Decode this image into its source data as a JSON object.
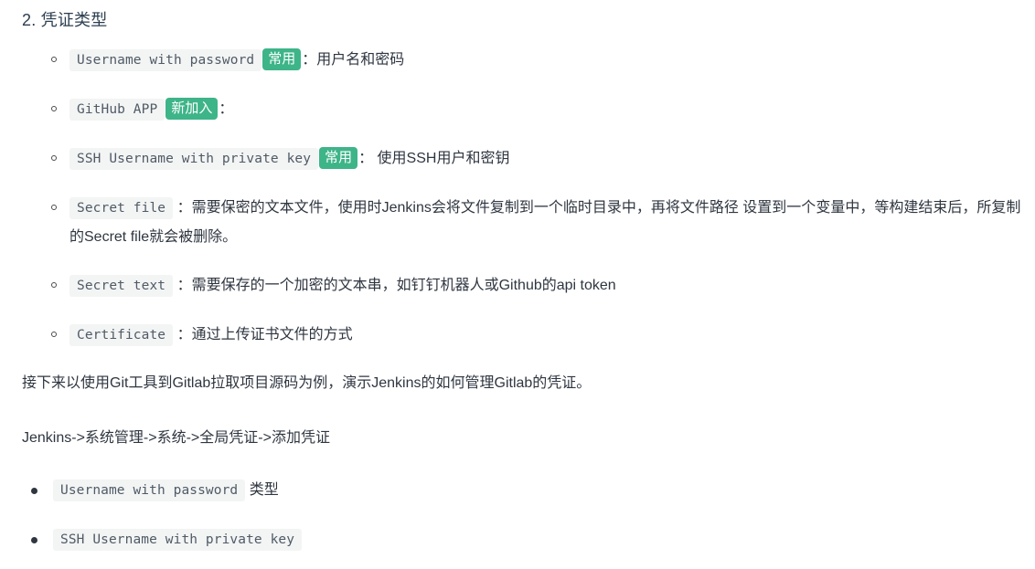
{
  "document": {
    "heading": "2. 凭证类型",
    "credential_types": [
      {
        "code": "Username with password",
        "badge": "常用",
        "separator": "：",
        "description": "用户名和密码",
        "extra_line": ""
      },
      {
        "code": "GitHub APP",
        "badge": "新加入",
        "separator": "：",
        "description": "",
        "extra_line": ""
      },
      {
        "code": "SSH Username with private key",
        "badge": "常用",
        "separator": "：",
        "description": " 使用SSH用户和密钥",
        "extra_line": ""
      },
      {
        "code": "Secret file",
        "badge": "",
        "separator": "：",
        "description": "需要保密的文本文件，使用时Jenkins会将文件复制到一个临时目录中，再将文件路径 设置到一个",
        "extra_line": "变量中，等构建结束后，所复制的Secret file就会被删除。"
      },
      {
        "code": "Secret text",
        "badge": "",
        "separator": "：",
        "description": "需要保存的一个加密的文本串，如钉钉机器人或Github的api token",
        "extra_line": ""
      },
      {
        "code": "Certificate",
        "badge": "",
        "separator": "：",
        "description": "通过上传证书文件的方式",
        "extra_line": ""
      }
    ],
    "paragraphs": [
      "接下来以使用Git工具到Gitlab拉取项目源码为例，演示Jenkins的如何管理Gitlab的凭证。",
      "Jenkins->系统管理->系统->全局凭证->添加凭证"
    ],
    "examples": [
      {
        "code": "Username with password",
        "suffix": " 类型"
      },
      {
        "code": "SSH Username with private key",
        "suffix": ""
      }
    ],
    "colors": {
      "badge_background": "#3eb489",
      "badge_text": "#ffffff",
      "code_background": "#f3f4f4",
      "code_text": "#4f5b66",
      "body_text": "#2f3640",
      "page_background": "#ffffff"
    }
  }
}
